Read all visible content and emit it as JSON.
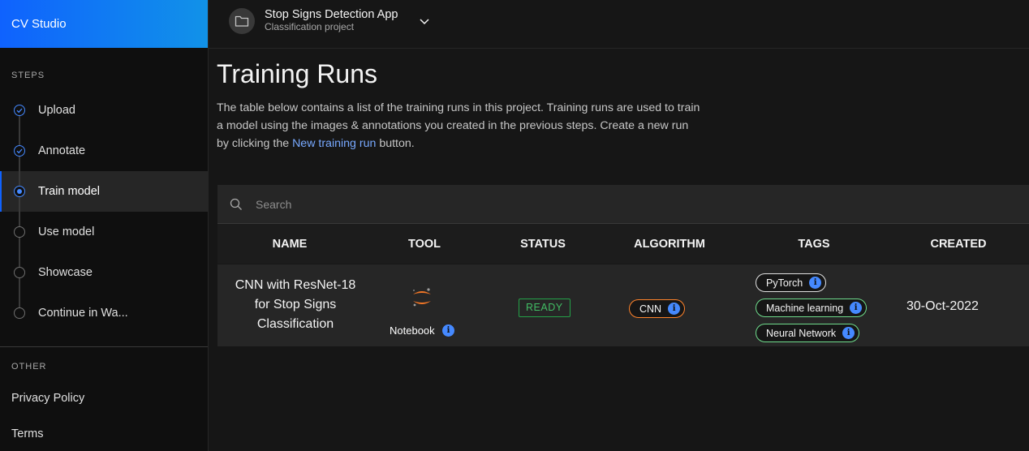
{
  "sidebar": {
    "brand": "CV Studio",
    "steps_label": "STEPS",
    "steps": [
      {
        "label": "Upload",
        "state": "done"
      },
      {
        "label": "Annotate",
        "state": "done"
      },
      {
        "label": "Train model",
        "state": "current"
      },
      {
        "label": "Use model",
        "state": "todo"
      },
      {
        "label": "Showcase",
        "state": "todo"
      },
      {
        "label": "Continue in Wa...",
        "state": "todo"
      }
    ],
    "other_label": "OTHER",
    "other_links": [
      "Privacy Policy",
      "Terms"
    ]
  },
  "header": {
    "app_name": "Stop Signs Detection App",
    "app_subtitle": "Classification project"
  },
  "main": {
    "title": "Training Runs",
    "description_pre": "The table below contains a list of the training runs in this project. Training runs are used to train a model using the images & annotations you created in the previous steps. Create a new run by clicking the ",
    "description_link": "New training run",
    "description_post": " button."
  },
  "table": {
    "search_placeholder": "Search",
    "headers": [
      "NAME",
      "TOOL",
      "STATUS",
      "ALGORITHM",
      "TAGS",
      "CREATED"
    ],
    "rows": [
      {
        "name": "CNN with ResNet-18 for Stop Signs Classification",
        "tool": "Notebook",
        "status": "READY",
        "algorithm": "CNN",
        "tags": [
          "PyTorch",
          "Machine learning",
          "Neural Network"
        ],
        "created": "30-Oct-2022"
      }
    ]
  },
  "colors": {
    "brand_gradient_start": "#0f62fe",
    "brand_gradient_end": "#1192e8",
    "status_ready": "#42be65",
    "algorithm_border": "#ff832b",
    "tag_border": "#6fdc8c",
    "link": "#78a9ff",
    "info_icon": "#4589ff"
  }
}
